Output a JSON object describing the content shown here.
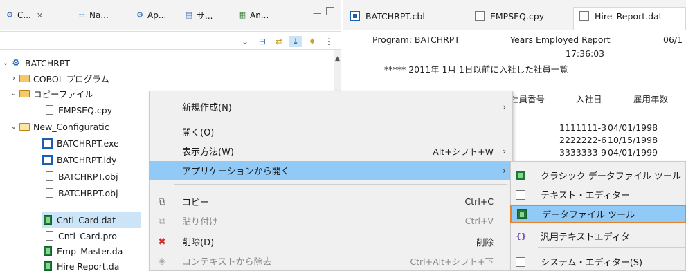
{
  "left_tabs": [
    {
      "label": "C...",
      "icon": "project-explorer-icon"
    },
    {
      "label": "Na...",
      "icon": "navigator-icon"
    },
    {
      "label": "Ap...",
      "icon": "application-explorer-icon"
    },
    {
      "label": "サ...",
      "icon": "server-icon"
    },
    {
      "label": "An...",
      "icon": "analysis-icon"
    }
  ],
  "tree": {
    "project": "BATCHRPT",
    "cobol_folder": "COBOL プログラム",
    "copy_folder": "コピーファイル",
    "copy_file": "EMPSEQ.cpy",
    "config_folder": "New_Configuratic",
    "files": [
      "BATCHRPT.exe",
      "BATCHRPT.idy",
      "BATCHRPT.obj",
      "BATCHRPT.obj",
      "Cntl_Card.dat",
      "Cntl_Card.pro",
      "Emp_Master.da",
      "Hire Report.da"
    ]
  },
  "editor_tabs": [
    {
      "label": "BATCHRPT.cbl",
      "icon": "cobol-file-icon"
    },
    {
      "label": "EMPSEQ.cpy",
      "icon": "copy-file-icon"
    },
    {
      "label": "Hire_Report.dat",
      "icon": "data-file-icon"
    }
  ],
  "report": {
    "program": "Program: BATCHRPT",
    "title": "Years Employed Report",
    "date": "06/1",
    "time": "17:36:03",
    "heading": "***** 2011年 1月 1日以前に入社した社員一覧",
    "col_emp": "社員番号",
    "col_hire": "入社日",
    "col_years": "雇用年数",
    "rows": [
      {
        "id": "1111111-3",
        "date": "04/01/1998"
      },
      {
        "id": "2222222-6",
        "date": "10/15/1998"
      },
      {
        "id": "3333333-9",
        "date": "04/01/1999"
      }
    ]
  },
  "context_menu": {
    "new": "新規作成(N)",
    "open": "開く(O)",
    "show_in": "表示方法(W)",
    "show_in_shortcut": "Alt+シフト+W",
    "open_with": "アプリケーションから開く",
    "copy": "コピー",
    "copy_shortcut": "Ctrl+C",
    "paste": "貼り付け",
    "paste_shortcut": "Ctrl+V",
    "delete": "削除(D)",
    "delete_shortcut": "削除",
    "remove_context": "コンテキストから除去",
    "remove_context_shortcut": "Ctrl+Alt+シフト+下"
  },
  "submenu": {
    "classic_data_tool": "クラシック データファイル ツール",
    "text_editor": "テキスト・エディター",
    "data_file_tool": "データファイル ツール",
    "generic_text_editor": "汎用テキストエディタ",
    "system_editor": "システム・エディター(S)"
  }
}
